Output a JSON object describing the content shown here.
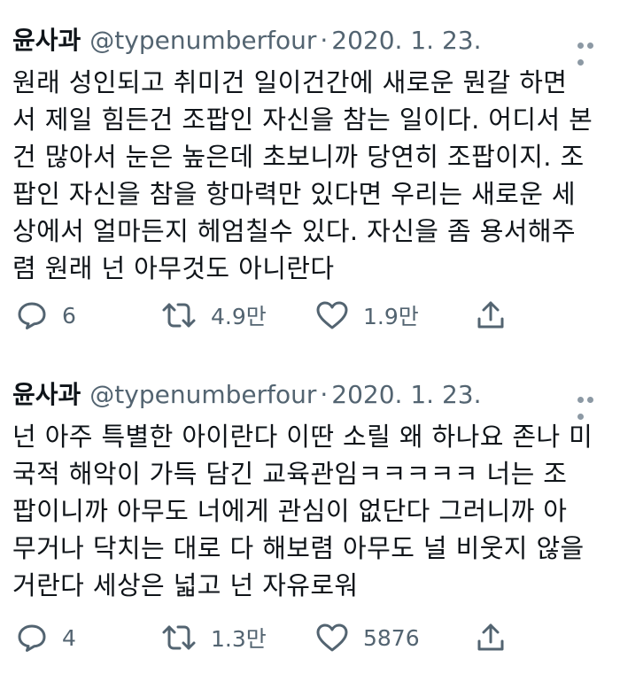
{
  "tweets": [
    {
      "name": "윤사과",
      "handle": "@typenumberfour",
      "separator": "·",
      "date": "2020. 1. 23.",
      "lines": [
        "원래 성인되고 취미건 일이건간에 새로운 뭔갈 하면",
        "서 제일 힘든건 조팝인 자신을 참는 일이다. 어디서 본",
        "건 많아서 눈은 높은데 초보니까 당연히 조팝이지. 조",
        "팝인 자신을 참을 항마력만 있다면 우리는 새로운 세",
        "상에서 얼마든지 헤엄칠수 있다. 자신을 좀 용서해주",
        "렴 원래 넌 아무것도 아니란다"
      ],
      "replies": "6",
      "retweets": "4.9만",
      "likes": "1.9만"
    },
    {
      "name": "윤사과",
      "handle": "@typenumberfour",
      "separator": "·",
      "date": "2020. 1. 23.",
      "lines": [
        "넌 아주 특별한 아이란다 이딴 소릴 왜 하나요 존나 미",
        "국적 해악이 가득 담긴 교육관임ㅋㅋㅋㅋㅋ 너는 조",
        "팝이니까 아무도 너에게 관심이 없단다 그러니까 아",
        "무거나 닥치는 대로 다 해보렴 아무도 널 비웃지 않을",
        "거란다 세상은 넓고 넌 자유로워"
      ],
      "replies": "4",
      "retweets": "1.3만",
      "likes": "5876"
    }
  ],
  "icons": {
    "more": "more-icon",
    "reply": "reply-icon",
    "retweet": "retweet-icon",
    "like": "heart-icon",
    "share": "share-icon"
  },
  "colors": {
    "text": "#0f1419",
    "secondary": "#536471"
  }
}
